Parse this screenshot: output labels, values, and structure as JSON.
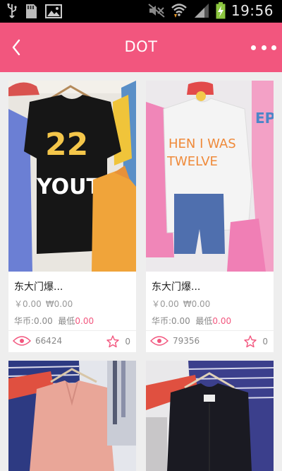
{
  "statusbar": {
    "time": "19:56",
    "icons": [
      "usb-icon",
      "sd-card-icon",
      "image-icon",
      "mute-icon",
      "wifi-icon",
      "signal-icon",
      "battery-charging-icon"
    ]
  },
  "header": {
    "title": "DOT",
    "back_icon": "chevron-left-icon",
    "more_icon": "more-dots-icon"
  },
  "colors": {
    "accent": "#f2567e",
    "background": "#eeeeee"
  },
  "products": [
    {
      "name": "东大门爆...",
      "price": "￥0.00",
      "price_w": "₩0.00",
      "coin_label": "华币:",
      "coin_value": "0.00",
      "low_label": "最低",
      "low_value": "0.00",
      "views": "66424",
      "favorites": "0"
    },
    {
      "name": "东大门爆...",
      "price": "￥0.00",
      "price_w": "₩0.00",
      "coin_label": "华币:",
      "coin_value": "0.00",
      "low_label": "最低",
      "low_value": "0.00",
      "views": "79356",
      "favorites": "0"
    },
    {},
    {}
  ]
}
